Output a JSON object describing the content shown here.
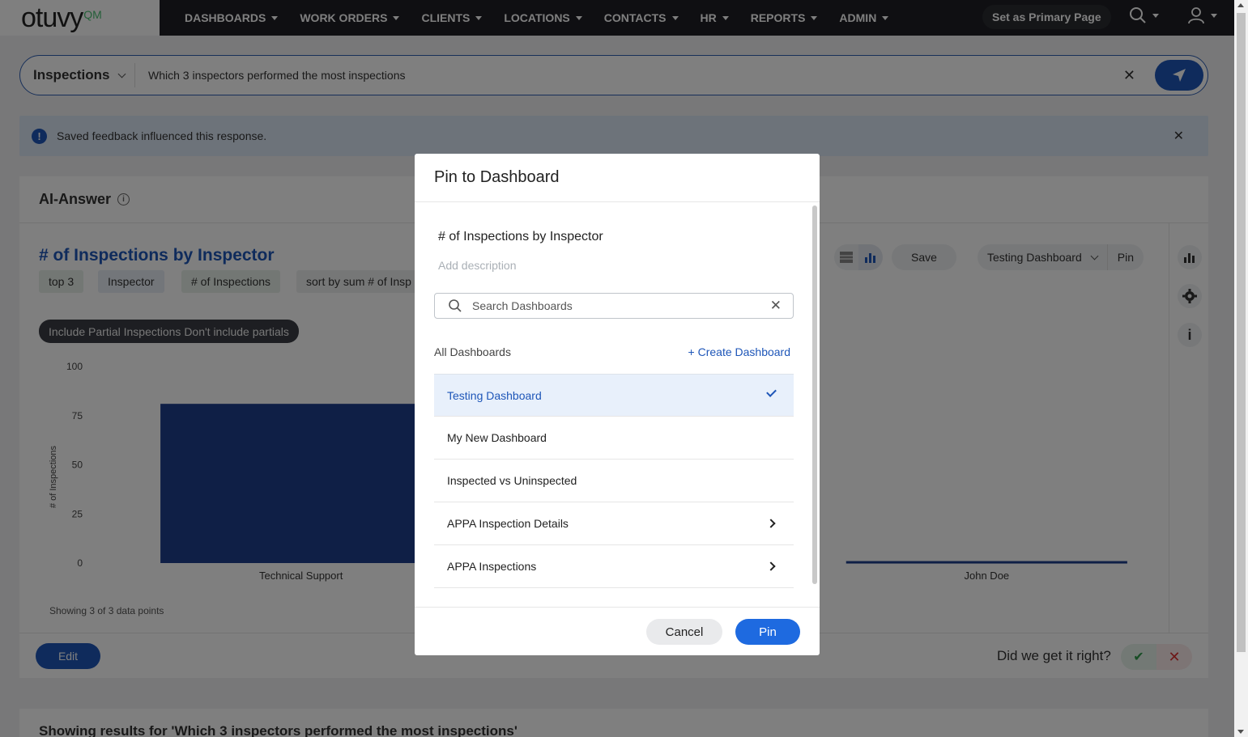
{
  "app": {
    "logo_text": "otuvy",
    "logo_suffix": "QM"
  },
  "nav": {
    "items": [
      {
        "label": "DASHBOARDS"
      },
      {
        "label": "WORK ORDERS"
      },
      {
        "label": "CLIENTS"
      },
      {
        "label": "LOCATIONS"
      },
      {
        "label": "CONTACTS"
      },
      {
        "label": "HR"
      },
      {
        "label": "REPORTS"
      },
      {
        "label": "ADMIN"
      }
    ],
    "primary_page_label": "Set as Primary Page"
  },
  "search": {
    "scope": "Inspections",
    "query": "Which 3 inspectors performed the most inspections"
  },
  "alert": {
    "text": "Saved feedback influenced this response."
  },
  "answer": {
    "heading": "AI-Answer",
    "viz_title": "# of Inspections by Inspector",
    "chips": [
      "top 3",
      "Inspector",
      "# of Inspections",
      "sort by sum # of Insp"
    ],
    "partial_toggle": "Include Partial Inspections Don't include partials",
    "toolbar": {
      "save_label": "Save",
      "dashboard_select": "Testing Dashboard",
      "pin_label": "Pin"
    },
    "showing_text": "Showing 3 of 3 data points",
    "edit_label": "Edit",
    "feedback_question": "Did we get it right?"
  },
  "chart_data": {
    "type": "bar",
    "categories": [
      "Technical Support",
      "",
      "John Doe"
    ],
    "values": [
      81,
      null,
      1
    ],
    "ylabel": "# of Inspections",
    "yticks": [
      "0",
      "25",
      "50",
      "75",
      "100"
    ],
    "ylim": [
      0,
      100
    ],
    "bar_color": "#1e3f8c"
  },
  "bottom": {
    "text": "Showing results for 'Which 3 inspectors performed the most inspections'"
  },
  "modal": {
    "title": "Pin to Dashboard",
    "viz_name": "# of Inspections by Inspector",
    "description_placeholder": "Add description",
    "search_placeholder": "Search Dashboards",
    "all_dashboards_label": "All Dashboards",
    "create_label": "+ Create Dashboard",
    "dashboards": [
      {
        "name": "Testing Dashboard",
        "selected": true,
        "has_children": false
      },
      {
        "name": "My New Dashboard",
        "selected": false,
        "has_children": false
      },
      {
        "name": "Inspected vs Uninspected",
        "selected": false,
        "has_children": false
      },
      {
        "name": "APPA Inspection Details",
        "selected": false,
        "has_children": true
      },
      {
        "name": "APPA Inspections",
        "selected": false,
        "has_children": true
      }
    ],
    "cancel_label": "Cancel",
    "pin_label": "Pin"
  }
}
